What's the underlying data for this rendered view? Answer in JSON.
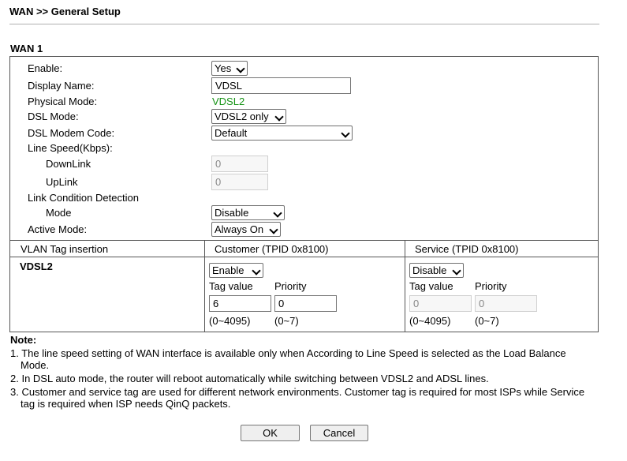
{
  "page": {
    "title": "WAN >> General Setup",
    "section": "WAN 1"
  },
  "form": {
    "enable": {
      "label": "Enable:",
      "value": "Yes"
    },
    "display_name": {
      "label": "Display Name:",
      "value": "VDSL"
    },
    "physical_mode": {
      "label": "Physical Mode:",
      "value": "VDSL2"
    },
    "dsl_mode": {
      "label": "DSL Mode:",
      "value": "VDSL2 only"
    },
    "dsl_modem_code": {
      "label": "DSL Modem Code:",
      "value": "Default"
    },
    "line_speed": {
      "label": "Line Speed(Kbps):",
      "downlink_label": "DownLink",
      "downlink_value": "0",
      "uplink_label": "UpLink",
      "uplink_value": "0"
    },
    "link_condition": {
      "label": "Link Condition Detection",
      "mode_label": "Mode",
      "mode_value": "Disable"
    },
    "active_mode": {
      "label": "Active Mode:",
      "value": "Always On"
    }
  },
  "vlan": {
    "header_col1": "VLAN Tag insertion",
    "header_col2": "Customer (TPID 0x8100)",
    "header_col3": "Service (TPID 0x8100)",
    "row_label": "VDSL2",
    "customer": {
      "enable": "Enable",
      "tag_label": "Tag value",
      "priority_label": "Priority",
      "tag_value": "6",
      "priority_value": "0",
      "tag_range": "(0~4095)",
      "priority_range": "(0~7)"
    },
    "service": {
      "enable": "Disable",
      "tag_label": "Tag value",
      "priority_label": "Priority",
      "tag_value": "0",
      "priority_value": "0",
      "tag_range": "(0~4095)",
      "priority_range": "(0~7)"
    }
  },
  "notes": {
    "title": "Note:",
    "n1a": "1. The line speed setting of WAN interface is available only when According to Line Speed is selected as the Load Balance",
    "n1b": "Mode.",
    "n2": "2. In DSL auto mode, the router will reboot automatically while switching between VDSL2 and ADSL lines.",
    "n3a": "3. Customer and service tag are used for different network environments. Customer tag is required for most ISPs while Service",
    "n3b": "tag is required when ISP needs QinQ packets."
  },
  "buttons": {
    "ok": "OK",
    "cancel": "Cancel"
  },
  "colors": {
    "physical_mode_value": "#159315"
  }
}
